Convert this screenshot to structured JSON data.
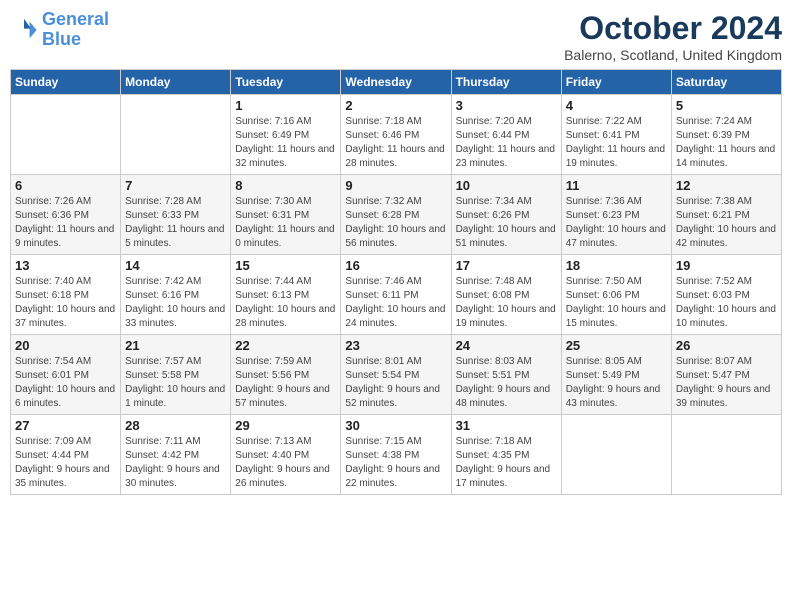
{
  "logo": {
    "line1": "General",
    "line2": "Blue"
  },
  "title": "October 2024",
  "location": "Balerno, Scotland, United Kingdom",
  "days_header": [
    "Sunday",
    "Monday",
    "Tuesday",
    "Wednesday",
    "Thursday",
    "Friday",
    "Saturday"
  ],
  "weeks": [
    [
      {
        "day": "",
        "sunrise": "",
        "sunset": "",
        "daylight": ""
      },
      {
        "day": "",
        "sunrise": "",
        "sunset": "",
        "daylight": ""
      },
      {
        "day": "1",
        "sunrise": "Sunrise: 7:16 AM",
        "sunset": "Sunset: 6:49 PM",
        "daylight": "Daylight: 11 hours and 32 minutes."
      },
      {
        "day": "2",
        "sunrise": "Sunrise: 7:18 AM",
        "sunset": "Sunset: 6:46 PM",
        "daylight": "Daylight: 11 hours and 28 minutes."
      },
      {
        "day": "3",
        "sunrise": "Sunrise: 7:20 AM",
        "sunset": "Sunset: 6:44 PM",
        "daylight": "Daylight: 11 hours and 23 minutes."
      },
      {
        "day": "4",
        "sunrise": "Sunrise: 7:22 AM",
        "sunset": "Sunset: 6:41 PM",
        "daylight": "Daylight: 11 hours and 19 minutes."
      },
      {
        "day": "5",
        "sunrise": "Sunrise: 7:24 AM",
        "sunset": "Sunset: 6:39 PM",
        "daylight": "Daylight: 11 hours and 14 minutes."
      }
    ],
    [
      {
        "day": "6",
        "sunrise": "Sunrise: 7:26 AM",
        "sunset": "Sunset: 6:36 PM",
        "daylight": "Daylight: 11 hours and 9 minutes."
      },
      {
        "day": "7",
        "sunrise": "Sunrise: 7:28 AM",
        "sunset": "Sunset: 6:33 PM",
        "daylight": "Daylight: 11 hours and 5 minutes."
      },
      {
        "day": "8",
        "sunrise": "Sunrise: 7:30 AM",
        "sunset": "Sunset: 6:31 PM",
        "daylight": "Daylight: 11 hours and 0 minutes."
      },
      {
        "day": "9",
        "sunrise": "Sunrise: 7:32 AM",
        "sunset": "Sunset: 6:28 PM",
        "daylight": "Daylight: 10 hours and 56 minutes."
      },
      {
        "day": "10",
        "sunrise": "Sunrise: 7:34 AM",
        "sunset": "Sunset: 6:26 PM",
        "daylight": "Daylight: 10 hours and 51 minutes."
      },
      {
        "day": "11",
        "sunrise": "Sunrise: 7:36 AM",
        "sunset": "Sunset: 6:23 PM",
        "daylight": "Daylight: 10 hours and 47 minutes."
      },
      {
        "day": "12",
        "sunrise": "Sunrise: 7:38 AM",
        "sunset": "Sunset: 6:21 PM",
        "daylight": "Daylight: 10 hours and 42 minutes."
      }
    ],
    [
      {
        "day": "13",
        "sunrise": "Sunrise: 7:40 AM",
        "sunset": "Sunset: 6:18 PM",
        "daylight": "Daylight: 10 hours and 37 minutes."
      },
      {
        "day": "14",
        "sunrise": "Sunrise: 7:42 AM",
        "sunset": "Sunset: 6:16 PM",
        "daylight": "Daylight: 10 hours and 33 minutes."
      },
      {
        "day": "15",
        "sunrise": "Sunrise: 7:44 AM",
        "sunset": "Sunset: 6:13 PM",
        "daylight": "Daylight: 10 hours and 28 minutes."
      },
      {
        "day": "16",
        "sunrise": "Sunrise: 7:46 AM",
        "sunset": "Sunset: 6:11 PM",
        "daylight": "Daylight: 10 hours and 24 minutes."
      },
      {
        "day": "17",
        "sunrise": "Sunrise: 7:48 AM",
        "sunset": "Sunset: 6:08 PM",
        "daylight": "Daylight: 10 hours and 19 minutes."
      },
      {
        "day": "18",
        "sunrise": "Sunrise: 7:50 AM",
        "sunset": "Sunset: 6:06 PM",
        "daylight": "Daylight: 10 hours and 15 minutes."
      },
      {
        "day": "19",
        "sunrise": "Sunrise: 7:52 AM",
        "sunset": "Sunset: 6:03 PM",
        "daylight": "Daylight: 10 hours and 10 minutes."
      }
    ],
    [
      {
        "day": "20",
        "sunrise": "Sunrise: 7:54 AM",
        "sunset": "Sunset: 6:01 PM",
        "daylight": "Daylight: 10 hours and 6 minutes."
      },
      {
        "day": "21",
        "sunrise": "Sunrise: 7:57 AM",
        "sunset": "Sunset: 5:58 PM",
        "daylight": "Daylight: 10 hours and 1 minute."
      },
      {
        "day": "22",
        "sunrise": "Sunrise: 7:59 AM",
        "sunset": "Sunset: 5:56 PM",
        "daylight": "Daylight: 9 hours and 57 minutes."
      },
      {
        "day": "23",
        "sunrise": "Sunrise: 8:01 AM",
        "sunset": "Sunset: 5:54 PM",
        "daylight": "Daylight: 9 hours and 52 minutes."
      },
      {
        "day": "24",
        "sunrise": "Sunrise: 8:03 AM",
        "sunset": "Sunset: 5:51 PM",
        "daylight": "Daylight: 9 hours and 48 minutes."
      },
      {
        "day": "25",
        "sunrise": "Sunrise: 8:05 AM",
        "sunset": "Sunset: 5:49 PM",
        "daylight": "Daylight: 9 hours and 43 minutes."
      },
      {
        "day": "26",
        "sunrise": "Sunrise: 8:07 AM",
        "sunset": "Sunset: 5:47 PM",
        "daylight": "Daylight: 9 hours and 39 minutes."
      }
    ],
    [
      {
        "day": "27",
        "sunrise": "Sunrise: 7:09 AM",
        "sunset": "Sunset: 4:44 PM",
        "daylight": "Daylight: 9 hours and 35 minutes."
      },
      {
        "day": "28",
        "sunrise": "Sunrise: 7:11 AM",
        "sunset": "Sunset: 4:42 PM",
        "daylight": "Daylight: 9 hours and 30 minutes."
      },
      {
        "day": "29",
        "sunrise": "Sunrise: 7:13 AM",
        "sunset": "Sunset: 4:40 PM",
        "daylight": "Daylight: 9 hours and 26 minutes."
      },
      {
        "day": "30",
        "sunrise": "Sunrise: 7:15 AM",
        "sunset": "Sunset: 4:38 PM",
        "daylight": "Daylight: 9 hours and 22 minutes."
      },
      {
        "day": "31",
        "sunrise": "Sunrise: 7:18 AM",
        "sunset": "Sunset: 4:35 PM",
        "daylight": "Daylight: 9 hours and 17 minutes."
      },
      {
        "day": "",
        "sunrise": "",
        "sunset": "",
        "daylight": ""
      },
      {
        "day": "",
        "sunrise": "",
        "sunset": "",
        "daylight": ""
      }
    ]
  ]
}
